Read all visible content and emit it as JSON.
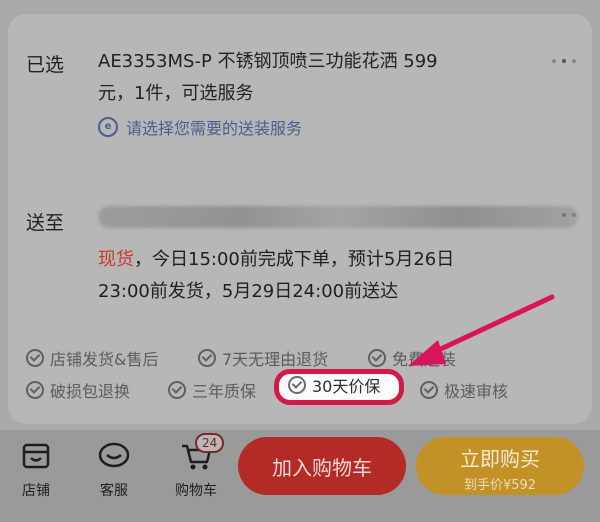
{
  "selected": {
    "label": "已选",
    "product_line1": "AE3353MS-P 不锈钢顶喷三功能花洒 599",
    "product_line2": "元，1件，可选服务",
    "service_link": "请选择您需要的送装服务"
  },
  "delivery": {
    "label": "送至",
    "stock_word": "现货",
    "stock_line1_rest": "，今日15:00前完成下单，预计5月26日",
    "stock_line2": "23:00前发货，5月29日24:00前送达"
  },
  "service_tags": [
    "店铺发货&售后",
    "7天无理由退货",
    "免费送装",
    "破损包退换",
    "三年质保",
    "30天价保",
    "极速审核"
  ],
  "bottom_bar": {
    "store_label": "店铺",
    "service_label": "客服",
    "cart_label": "购物车",
    "cart_count": "24",
    "add_to_cart": "加入购物车",
    "buy_now": "立即购买",
    "buy_price": "到手价¥592"
  },
  "colors": {
    "highlight_red": "#d11a44",
    "stock_red": "#c73b2b",
    "cart_button": "#b42a26",
    "buy_button": "#c39227",
    "link_blue": "#4a5f8f"
  }
}
